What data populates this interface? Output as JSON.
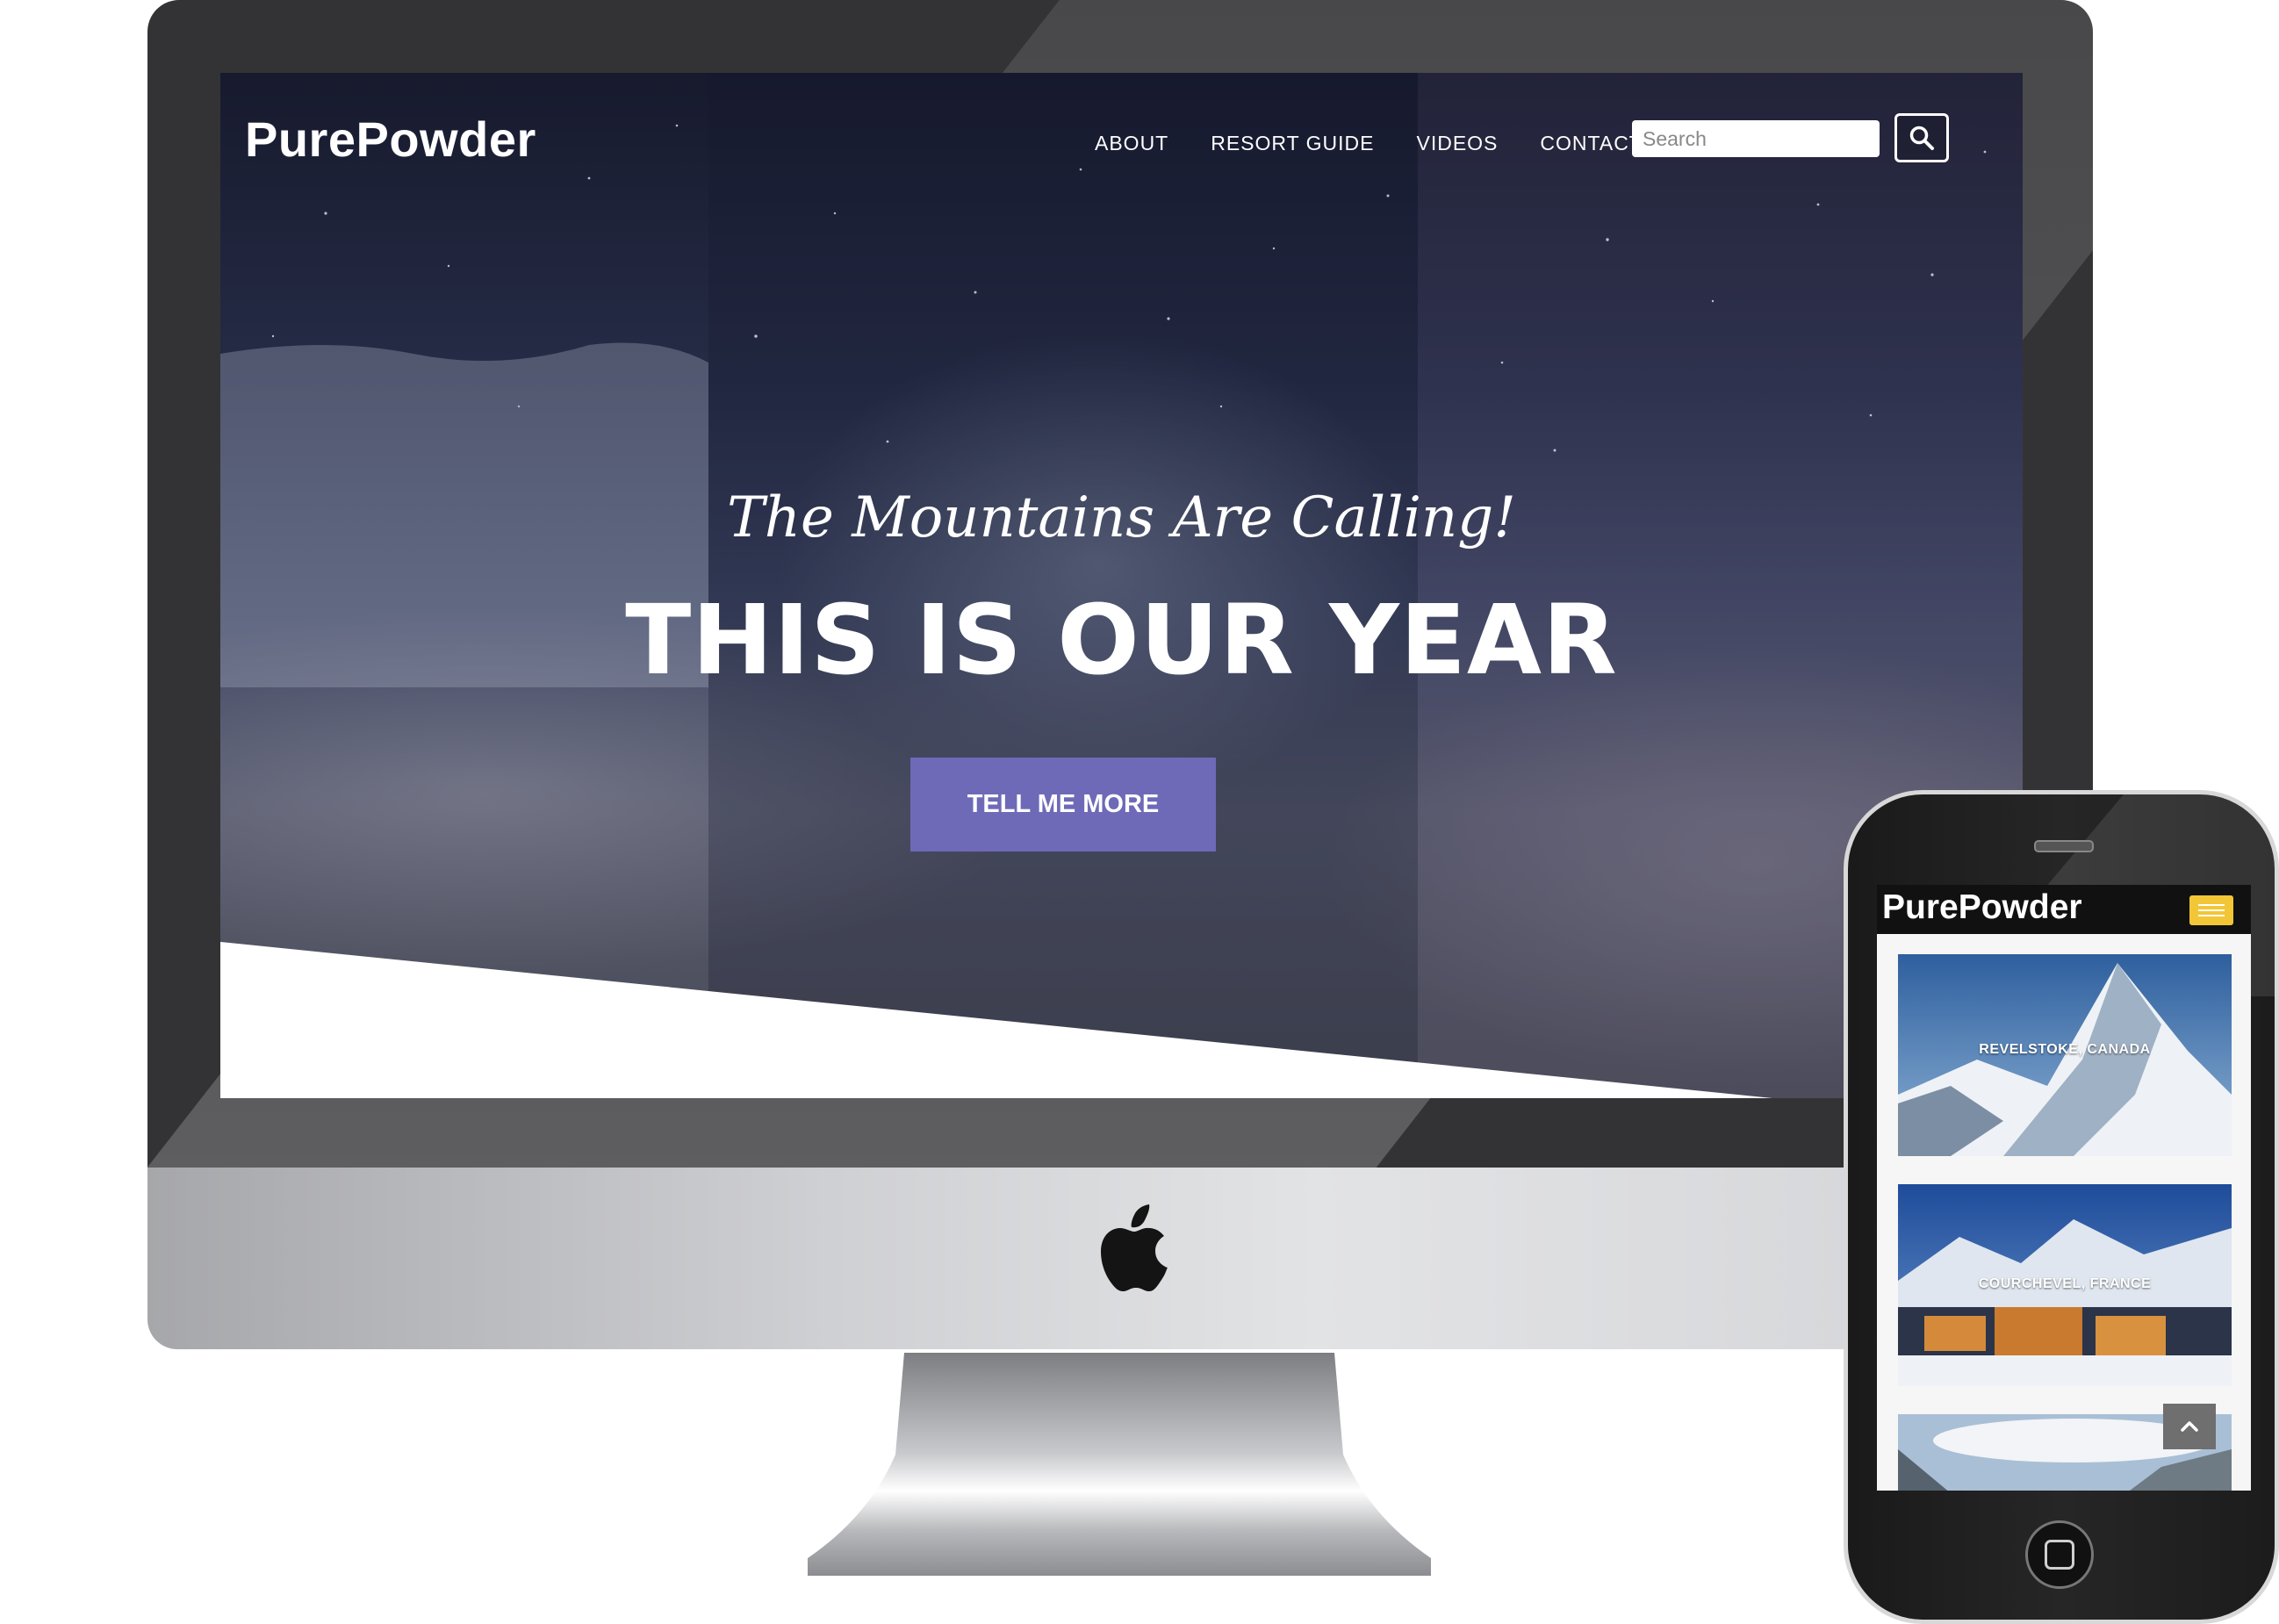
{
  "desktop": {
    "brand": "PurePowder",
    "nav": {
      "items": [
        {
          "label": "ABOUT"
        },
        {
          "label": "RESORT GUIDE"
        },
        {
          "label": "VIDEOS"
        },
        {
          "label": "CONTACT"
        }
      ]
    },
    "search": {
      "placeholder": "Search",
      "value": "",
      "icon": "search-icon"
    },
    "hero": {
      "tagline": "The Mountains Are Calling!",
      "headline": "THIS IS OUR YEAR",
      "cta_label": "TELL ME MORE"
    },
    "colors": {
      "cta": "#6e6ab8",
      "text": "#ffffff"
    }
  },
  "mobile": {
    "brand": "PurePowder",
    "menu_icon": "hamburger-icon",
    "cards": [
      {
        "label": "REVELSTOKE, CANADA"
      },
      {
        "label": "COURCHEVEL, FRANCE"
      },
      {
        "label": ""
      }
    ],
    "back_to_top_icon": "chevron-up-icon",
    "colors": {
      "header": "#111111",
      "menu_button": "#f2c636"
    }
  },
  "device": {
    "monitor_logo": "apple-logo-icon"
  }
}
